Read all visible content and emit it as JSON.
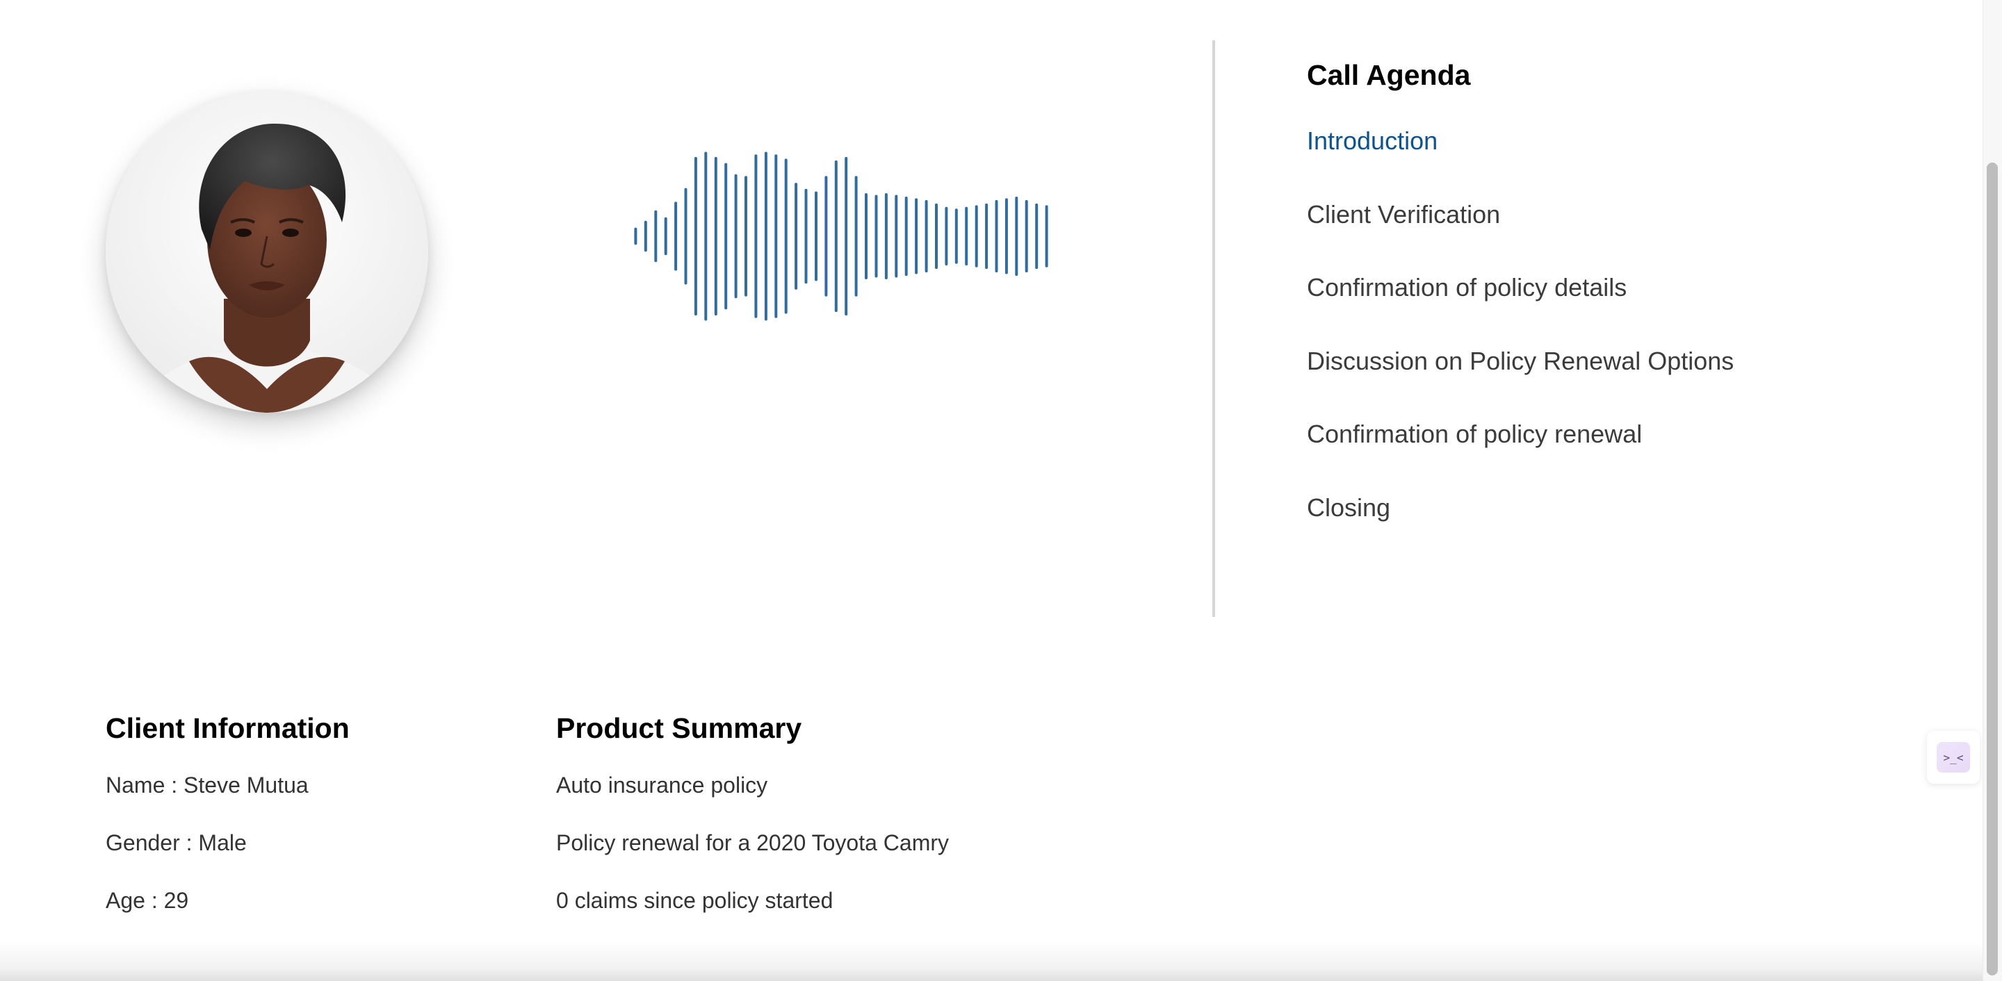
{
  "avatar": {
    "icon": "person-portrait"
  },
  "agenda": {
    "title": "Call Agenda",
    "items": [
      {
        "label": "Introduction",
        "active": true
      },
      {
        "label": "Client Verification",
        "active": false
      },
      {
        "label": "Confirmation of policy details",
        "active": false
      },
      {
        "label": "Discussion on Policy Renewal Options",
        "active": false
      },
      {
        "label": "Confirmation of policy renewal",
        "active": false
      },
      {
        "label": "Closing",
        "active": false
      }
    ],
    "active_color": "#0b5394"
  },
  "client_info": {
    "title": "Client Information",
    "lines": [
      "Name : Steve Mutua",
      "Gender : Male",
      "Age : 29"
    ]
  },
  "product_summary": {
    "title": "Product Summary",
    "lines": [
      "Auto insurance policy",
      "Policy renewal for a 2020 Toyota Camry",
      "0 claims since policy started"
    ]
  },
  "waveform": {
    "color": "#2e6da4",
    "levels": [
      0.1,
      0.18,
      0.3,
      0.22,
      0.4,
      0.56,
      0.92,
      0.98,
      0.92,
      0.85,
      0.72,
      0.7,
      0.95,
      0.98,
      0.95,
      0.9,
      0.62,
      0.55,
      0.52,
      0.7,
      0.88,
      0.92,
      0.7,
      0.5,
      0.48,
      0.5,
      0.48,
      0.46,
      0.44,
      0.42,
      0.38,
      0.34,
      0.32,
      0.34,
      0.36,
      0.38,
      0.42,
      0.44,
      0.46,
      0.42,
      0.38,
      0.36
    ]
  },
  "widget": {
    "icon": "chat-assistant-icon",
    "glyph": ">_<"
  },
  "colors": {
    "text": "#333333",
    "heading": "#000000",
    "divider": "#d6d6d6"
  }
}
